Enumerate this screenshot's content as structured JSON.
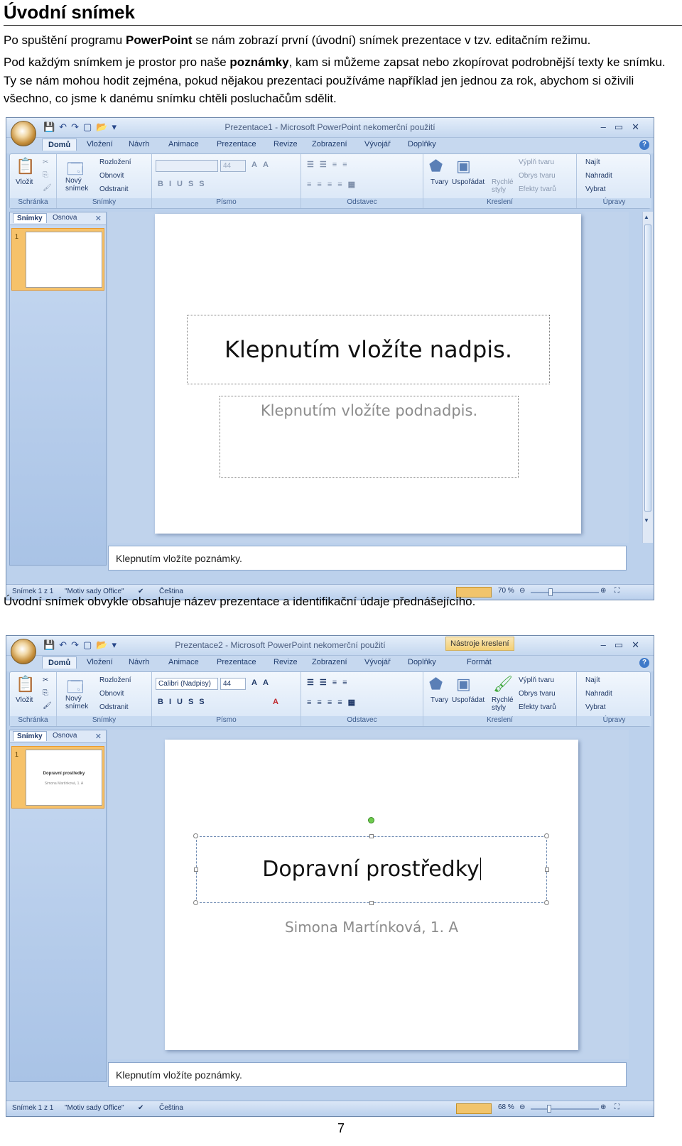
{
  "heading": "Úvodní snímek",
  "intro": {
    "p1_pre": "Po spuštění programu ",
    "p1_bold": "PowerPoint",
    "p1_post": " se nám zobrazí první (úvodní) snímek prezentace v tzv. editačním režimu.",
    "p2_pre": "Pod každým snímkem je prostor pro naše ",
    "p2_bold": "poznámky",
    "p2_post": ", kam si můžeme zapsat nebo zkopírovat podrobnější texty ke snímku. Ty se nám mohou hodit zejména, pokud nějakou prezentaci používáme například jen jednou za rok, abychom si oživili všechno, co jsme k danému snímku chtěli posluchačům sdělit."
  },
  "between_text": "Úvodní snímek obvykle obsahuje název prezentace a identifikační údaje přednášejícího.",
  "page_number": "7",
  "ribbon": {
    "tabs": [
      "Domů",
      "Vložení",
      "Návrh",
      "Animace",
      "Prezentace",
      "Revize",
      "Zobrazení",
      "Vývojář",
      "Doplňky"
    ],
    "format_tab": "Formát",
    "contextual_tag": "Nástroje kreslení",
    "vlozit": "Vložit",
    "novy_snimek": "Nový snímek",
    "rozlozeni": "Rozložení",
    "obnovit": "Obnovit",
    "odstranit": "Odstranit",
    "tvary": "Tvary",
    "usporadat": "Uspořádat",
    "rychle_styly": "Rychlé styly",
    "vypln": "Výplň tvaru",
    "obrys": "Obrys tvaru",
    "efekty": "Efekty tvarů",
    "najit": "Najít",
    "nahradit": "Nahradit",
    "vybrat": "Vybrat",
    "groups": {
      "schranka": "Schránka",
      "snimky": "Snímky",
      "pismo": "Písmo",
      "odstavec": "Odstavec",
      "kresleni": "Kreslení",
      "upravy": "Úpravy"
    }
  },
  "panel_tabs": {
    "snimky": "Snímky",
    "osnova": "Osnova"
  },
  "shot1": {
    "window_title": "Prezentace1 - Microsoft PowerPoint nekomerční použití",
    "font_name": "",
    "font_size": "44",
    "thumb_number": "1",
    "title_placeholder": "Klepnutím vložíte nadpis.",
    "subtitle_placeholder": "Klepnutím vložíte podnadpis.",
    "notes": "Klepnutím vložíte poznámky.",
    "status_slide": "Snímek 1 z 1",
    "status_theme": "\"Motiv sady Office\"",
    "status_lang": "Čeština",
    "zoom": "70 %"
  },
  "shot2": {
    "window_title": "Prezentace2 - Microsoft PowerPoint nekomerční použití",
    "font_name": "Calibri (Nadpisy)",
    "font_size": "44",
    "thumb_number": "1",
    "title": "Dopravní prostředky",
    "subtitle": "Simona Martínková, 1. A",
    "notes": "Klepnutím vložíte poznámky.",
    "status_slide": "Snímek 1 z 1",
    "status_theme": "\"Motiv sady Office\"",
    "status_lang": "Čeština",
    "zoom": "68 %"
  }
}
